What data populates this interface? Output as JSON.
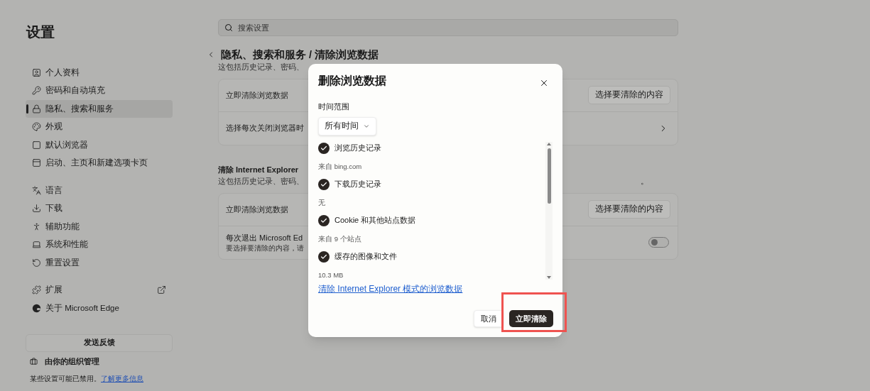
{
  "sidebar": {
    "title": "设置",
    "groups": [
      {
        "items": [
          {
            "label": "个人资料",
            "selected": false
          },
          {
            "label": "密码和自动填充",
            "selected": false
          },
          {
            "label": "隐私、搜索和服务",
            "selected": true
          },
          {
            "label": "外观",
            "selected": false
          },
          {
            "label": "默认浏览器",
            "selected": false
          },
          {
            "label": "启动、主页和新建选项卡页",
            "selected": false
          }
        ]
      },
      {
        "items": [
          {
            "label": "语言",
            "selected": false
          },
          {
            "label": "下载",
            "selected": false
          },
          {
            "label": "辅助功能",
            "selected": false
          },
          {
            "label": "系统和性能",
            "selected": false
          },
          {
            "label": "重置设置",
            "selected": false
          }
        ]
      },
      {
        "items": [
          {
            "label": "扩展",
            "selected": false,
            "external": true
          },
          {
            "label": "关于 Microsoft Edge",
            "selected": false,
            "external": false
          }
        ]
      }
    ],
    "feedback_button": "发送反馈",
    "managed": "由你的组织管理",
    "note": "某些设置可能已禁用。",
    "note_link": "了解更多信息"
  },
  "search": {
    "placeholder": "搜索设置"
  },
  "main": {
    "breadcrumb": "隐私、搜索和服务 / 清除浏览数据",
    "sections": [
      {
        "subtitle": "这包括历史记录、密码、",
        "rows": [
          {
            "kind": "button",
            "label": "立即清除浏览数据",
            "action": "选择要清除的内容"
          },
          {
            "kind": "link",
            "label": "选择每次关闭浏览器时"
          }
        ]
      },
      {
        "title": "清除 Internet Explorer",
        "subtitle": "这包括历史记录、密码、",
        "subtitle_tail": "。",
        "rows": [
          {
            "kind": "button",
            "label": "立即清除浏览数据",
            "action": "选择要清除的内容"
          },
          {
            "kind": "toggle",
            "label": "每次退出 Microsoft Ed",
            "hint": "要选择要清除的内容，请",
            "on": false
          }
        ]
      }
    ]
  },
  "dialog": {
    "title": "删除浏览数据",
    "time_range_label": "时间范围",
    "time_range_value": "所有时间",
    "options": [
      {
        "label": "浏览历史记录",
        "detail": "来自 bing.com",
        "checked": true
      },
      {
        "label": "下载历史记录",
        "detail": "无",
        "checked": true
      },
      {
        "label": "Cookie 和其他站点数据",
        "detail": "来自 9 个站点",
        "checked": true
      },
      {
        "label": "缓存的图像和文件",
        "detail": "10.3 MB",
        "checked": true
      }
    ],
    "ie_link": "清除 Internet Explorer 模式的浏览数据",
    "cancel": "取消",
    "confirm": "立即清除",
    "confirm_highlighted": true
  }
}
